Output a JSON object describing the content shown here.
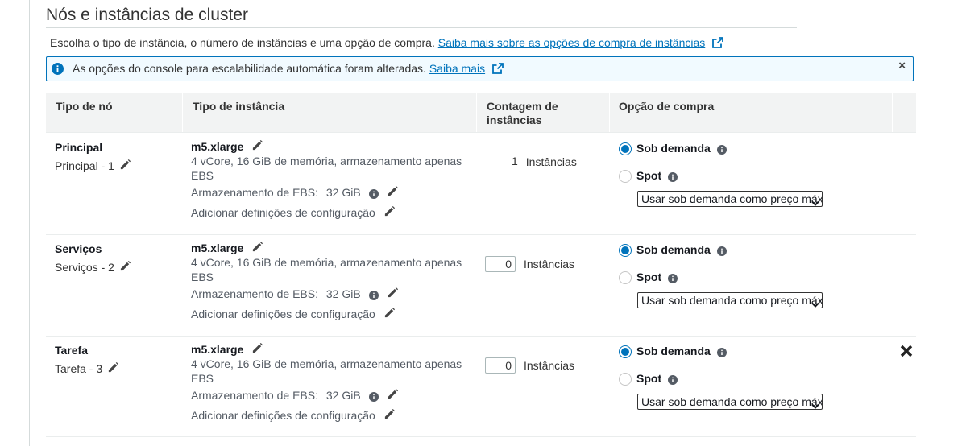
{
  "section": {
    "title": "Nós e instâncias de cluster",
    "description": "Escolha o tipo de instância, o número de instâncias e uma opção de compra.",
    "learn_more_link": "Saiba mais sobre as opções de compra de instâncias"
  },
  "notice": {
    "text": "As opções do console para escalabilidade automática foram alteradas.",
    "link": "Saiba mais",
    "close_symbol": "×"
  },
  "table": {
    "headers": {
      "node_type": "Tipo de nó",
      "instance_type": "Tipo de instância",
      "instance_count_line1": "Contagem de",
      "instance_count_line2": "instâncias",
      "purchase_option": "Opção de compra"
    },
    "rows": [
      {
        "node": "Principal",
        "node_label": "Principal - 1",
        "instance_type": "m5.xlarge",
        "instance_detail": "4 vCore, 16 GiB de memória, armazenamento apenas EBS",
        "ebs_label": "Armazenamento de EBS:",
        "ebs_value": "32 GiB",
        "config_label": "Adicionar definições de configuração",
        "count": "1",
        "count_label": "Instâncias",
        "count_editable": false,
        "on_demand_label": "Sob demanda",
        "spot_label": "Spot",
        "selected_option": "Sob demanda",
        "spot_select_value": "Usar sob demanda como preço máximo",
        "removable": false
      },
      {
        "node": "Serviços",
        "node_label": "Serviços - 2",
        "instance_type": "m5.xlarge",
        "instance_detail": "4 vCore, 16 GiB de memória, armazenamento apenas EBS",
        "ebs_label": "Armazenamento de EBS:",
        "ebs_value": "32 GiB",
        "config_label": "Adicionar definições de configuração",
        "count": "0",
        "count_label": "Instâncias",
        "count_editable": true,
        "on_demand_label": "Sob demanda",
        "spot_label": "Spot",
        "selected_option": "Sob demanda",
        "spot_select_value": "Usar sob demanda como preço máximo",
        "removable": false
      },
      {
        "node": "Tarefa",
        "node_label": "Tarefa - 3",
        "instance_type": "m5.xlarge",
        "instance_detail": "4 vCore, 16 GiB de memória, armazenamento apenas EBS",
        "ebs_label": "Armazenamento de EBS:",
        "ebs_value": "32 GiB",
        "config_label": "Adicionar definições de configuração",
        "count": "0",
        "count_label": "Instâncias",
        "count_editable": true,
        "on_demand_label": "Sob demanda",
        "spot_label": "Spot",
        "selected_option": "Sob demanda",
        "spot_select_value": "Usar sob demanda como preço máximo",
        "removable": true
      }
    ]
  },
  "colors": {
    "link": "#0073bb",
    "notice_border": "#0073bb",
    "notice_bg": "#f1faff",
    "header_bg": "#f2f3f3"
  },
  "icons": [
    "info-icon",
    "external-link-icon",
    "close-icon",
    "pencil-icon",
    "info-circle-icon",
    "chevron-down-icon",
    "remove-x-icon"
  ]
}
